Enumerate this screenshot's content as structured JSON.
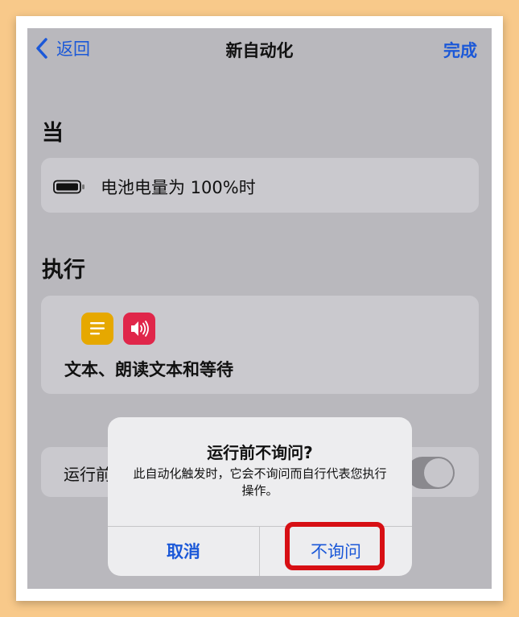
{
  "nav": {
    "back_label": "返回",
    "title": "新自动化",
    "done_label": "完成"
  },
  "when": {
    "header": "当",
    "trigger": "电池电量为 100%时"
  },
  "do": {
    "header": "执行",
    "actions_summary": "文本、朗读文本和等待",
    "icons": [
      "text-icon",
      "speak-text-icon"
    ]
  },
  "run_row": {
    "label_visible": "运行前"
  },
  "alert": {
    "title": "运行前不询问?",
    "message": "此自动化触发时，它会不询问而自行代表您执行操作。",
    "cancel_label": "取消",
    "confirm_label": "不询问"
  },
  "colors": {
    "accent": "#1b58d8",
    "highlight": "#d70f14",
    "text_icon": "#e6a800",
    "speak_icon": "#e0264a"
  }
}
